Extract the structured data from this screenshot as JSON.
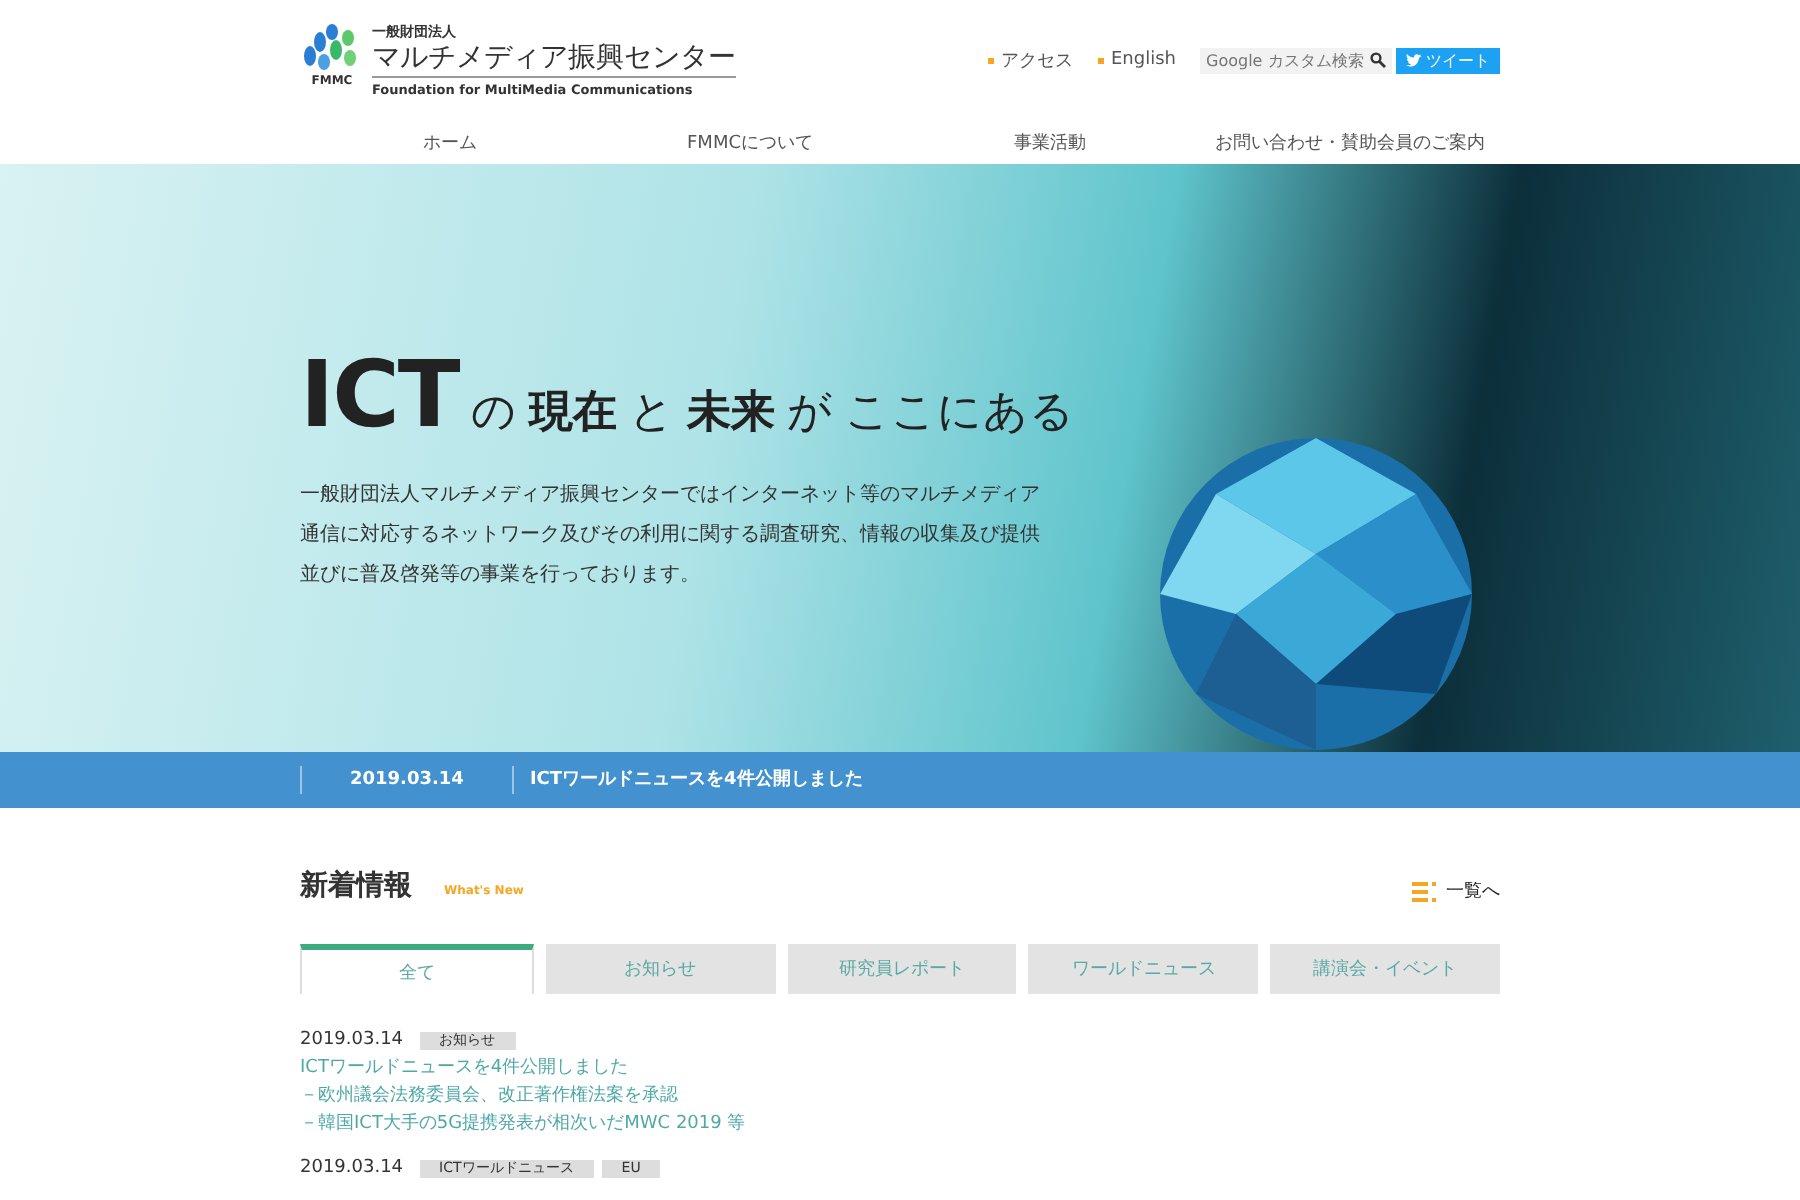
{
  "header": {
    "logo_small": "一般財団法人",
    "logo_name": "マルチメディア振興センター",
    "logo_abbr": "FMMC",
    "logo_english": "Foundation for MultiMedia Communications",
    "links": [
      "アクセス",
      "English"
    ],
    "search": {
      "placeholder": "Google カスタム検索"
    },
    "tweet_button": "ツイート"
  },
  "nav": [
    {
      "label": "ホーム"
    },
    {
      "label": "FMMCについて"
    },
    {
      "label": "事業活動"
    },
    {
      "label": "お問い合わせ・賛助会員のご案内"
    }
  ],
  "hero": {
    "headline_ict": "ICT",
    "headline_parts": [
      {
        "text": "の",
        "bold": false
      },
      {
        "text": "現在",
        "bold": true
      },
      {
        "text": "と",
        "bold": false
      },
      {
        "text": "未来",
        "bold": true
      },
      {
        "text": "が",
        "bold": false
      },
      {
        "text": "ここにある",
        "bold": false
      }
    ],
    "description": "一般財団法人マルチメディア振興センターではインターネット等のマルチメディア通信に対応するネットワーク及びその利用に関する調査研究、情報の収集及び提供並びに普及啓発等の事業を行っております。"
  },
  "ticker": {
    "date": "2019.03.14",
    "text": "ICTワールドニュースを4件公開しました"
  },
  "news": {
    "title": "新着情報",
    "subtitle": "What's New",
    "list_link": "一覧へ",
    "tabs": [
      {
        "label": "全て",
        "selected": true
      },
      {
        "label": "お知らせ",
        "selected": false
      },
      {
        "label": "研究員レポート",
        "selected": false
      },
      {
        "label": "ワールドニュース",
        "selected": false
      },
      {
        "label": "講演会・イベント",
        "selected": false
      }
    ],
    "items": [
      {
        "date": "2019.03.14",
        "tags": [
          "お知らせ"
        ],
        "lines": [
          "ICTワールドニュースを4件公開しました",
          "－欧州議会法務委員会、改正著作権法案を承認",
          "－韓国ICT大手の5G提携発表が相次いだMWC 2019 等"
        ]
      },
      {
        "date": "2019.03.14",
        "tags": [
          "ICTワールドニュース",
          "EU"
        ]
      }
    ]
  }
}
